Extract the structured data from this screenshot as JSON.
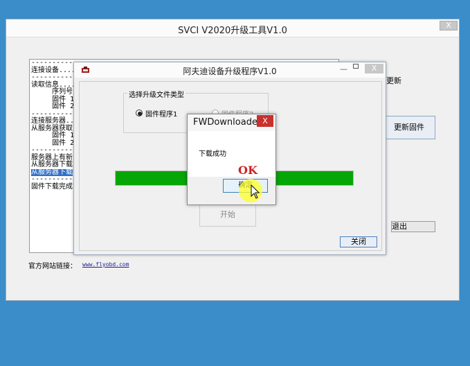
{
  "main_window": {
    "title": "SVCI V2020升级工具V1.0",
    "close_label": "X",
    "log_lines": [
      "-----------------",
      "连接设备.......",
      "-----------------",
      "读取信息.......",
      "     序列号：",
      "     固件 1 版",
      "     固件 2 版",
      "-----------------",
      "连接服务器...",
      "从服务器获取",
      "     固件 1 版",
      "     固件 2 版",
      "-----------------",
      "服务器上有新",
      "从服务器下载",
      "从服务器下载",
      "-----------------",
      "固件下载完成"
    ],
    "side_label": "更新",
    "update_firmware_label": "更新固件",
    "exit_label": "退出",
    "website_label": "官方网站链接：",
    "website_link": "www.flyobd.com"
  },
  "updater_window": {
    "title": "阿夫迪设备升级程序V1.0",
    "min_label": "—",
    "close_label": "X",
    "group_label": "选择升级文件类型",
    "radio1_label": "固件程序1",
    "radio2_label": "固件程序2",
    "start_label": "开始",
    "close_button_label": "关闭",
    "progress": 1.0
  },
  "message_box": {
    "title": "FWDownloader",
    "close_label": "X",
    "message": "下载成功",
    "ok_label": "确定"
  },
  "annotation": {
    "ok_text": "OK"
  }
}
